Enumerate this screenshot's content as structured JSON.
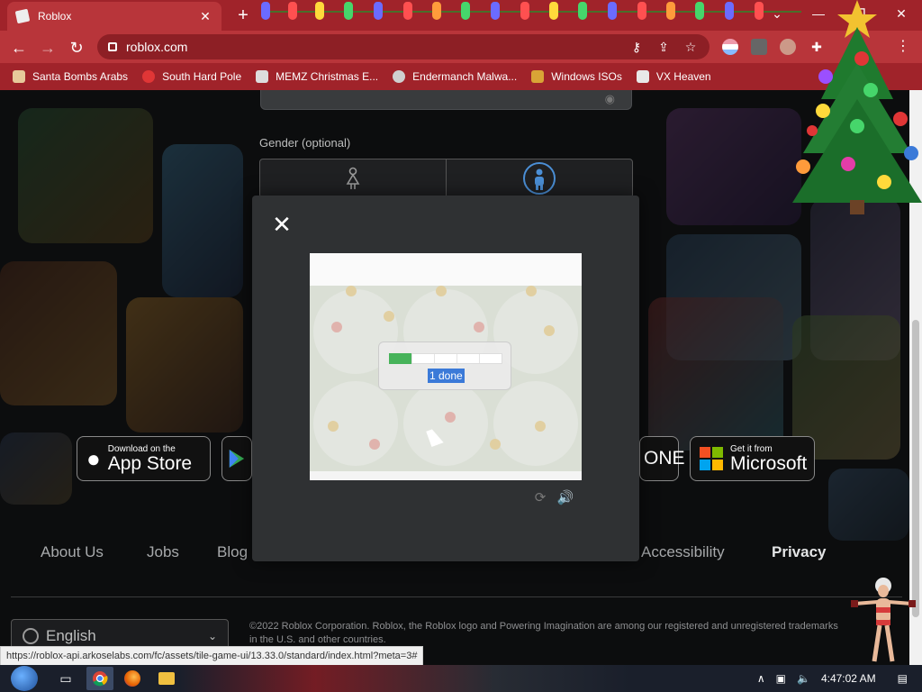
{
  "browser": {
    "tab_title": "Roblox",
    "tab_close": "✕",
    "new_tab": "+",
    "url": "roblox.com",
    "window_controls": [
      "⌄",
      "—",
      "❐",
      "✕"
    ],
    "bookmarks": [
      {
        "label": "Santa Bombs Arabs",
        "color": "#e7c99a"
      },
      {
        "label": "South Hard Pole",
        "color": "#e03636"
      },
      {
        "label": "MEMZ Christmas E...",
        "color": "#dddddd"
      },
      {
        "label": "Endermanch Malwa...",
        "color": "#cfcfcf"
      },
      {
        "label": "Windows ISOs",
        "color": "#d9a436"
      },
      {
        "label": "VX Heaven",
        "color": "#e8e8e8"
      }
    ],
    "status_url": "https://roblox-api.arkoselabs.com/fc/assets/tile-game-ui/13.33.0/standard/index.html?meta=3#"
  },
  "signup": {
    "gender_label": "Gender (optional)"
  },
  "app_badges": {
    "apple_small": "Download on the",
    "apple_big": "App Store",
    "xbox_partial": "ONE",
    "microsoft_small": "Get it from",
    "microsoft_big": "Microsoft"
  },
  "footer": {
    "links": [
      "About Us",
      "Jobs",
      "Blog",
      "Accessibility",
      "Privacy"
    ],
    "language": "English",
    "copyright": "©2022 Roblox Corporation. Roblox, the Roblox logo and Powering Imagination are among our registered and unregistered trademarks in the U.S. and other countries."
  },
  "captcha": {
    "close": "✕",
    "progress_label": "1 done",
    "progress_fraction": 0.2,
    "progress_segments": 5
  },
  "taskbar": {
    "time": "4:47:02 AM"
  },
  "colors": {
    "chrome_red": "#a0232a",
    "chrome_red_light": "#b8353a",
    "progress_green": "#47b35a",
    "selection_blue": "#3b7ad8"
  }
}
